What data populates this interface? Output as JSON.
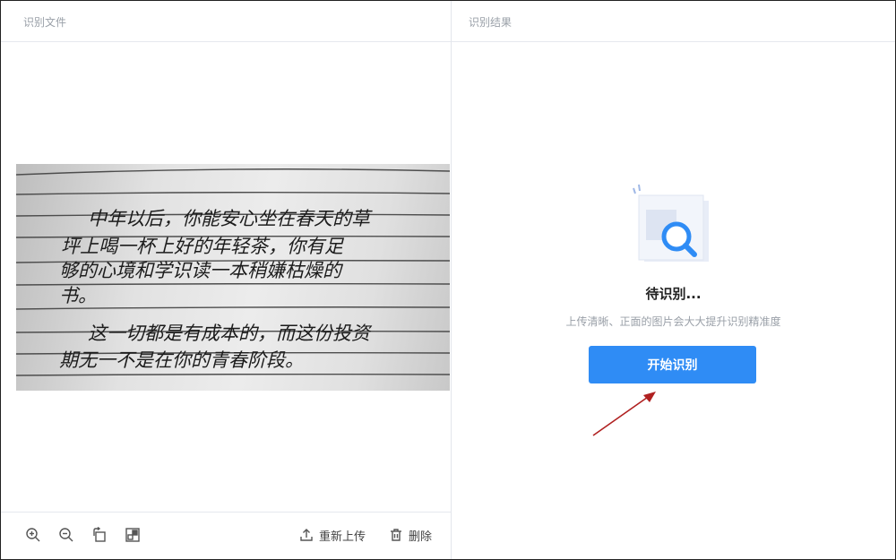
{
  "left_panel": {
    "title": "识别文件",
    "image_alt": "handwritten note photo",
    "handwriting_lines": [
      "中年以后，你能安心坐在春天的草",
      "坪上喝一杯上好的年轻茶，你有足",
      "够的心境和学识读一本稍嫌枯燥的",
      "书。",
      "这一切都是有成本的，而这份投资",
      "期无一不是在你的青春阶段。"
    ],
    "toolbar": {
      "zoom_in_icon": "zoom-in-icon",
      "zoom_out_icon": "zoom-out-icon",
      "rotate_icon": "rotate-icon",
      "fit_icon": "fit-screen-icon",
      "reupload_label": "重新上传",
      "delete_label": "删除"
    }
  },
  "right_panel": {
    "title": "识别结果",
    "status_title": "待识别...",
    "status_tip": "上传清晰、正面的图片会大大提升识别精准度",
    "start_button_label": "开始识别",
    "illustration_icon": "search-document-icon"
  },
  "colors": {
    "accent": "#2f8cf5",
    "annotation_arrow": "#b02020",
    "muted_text": "#9aa0a8"
  }
}
